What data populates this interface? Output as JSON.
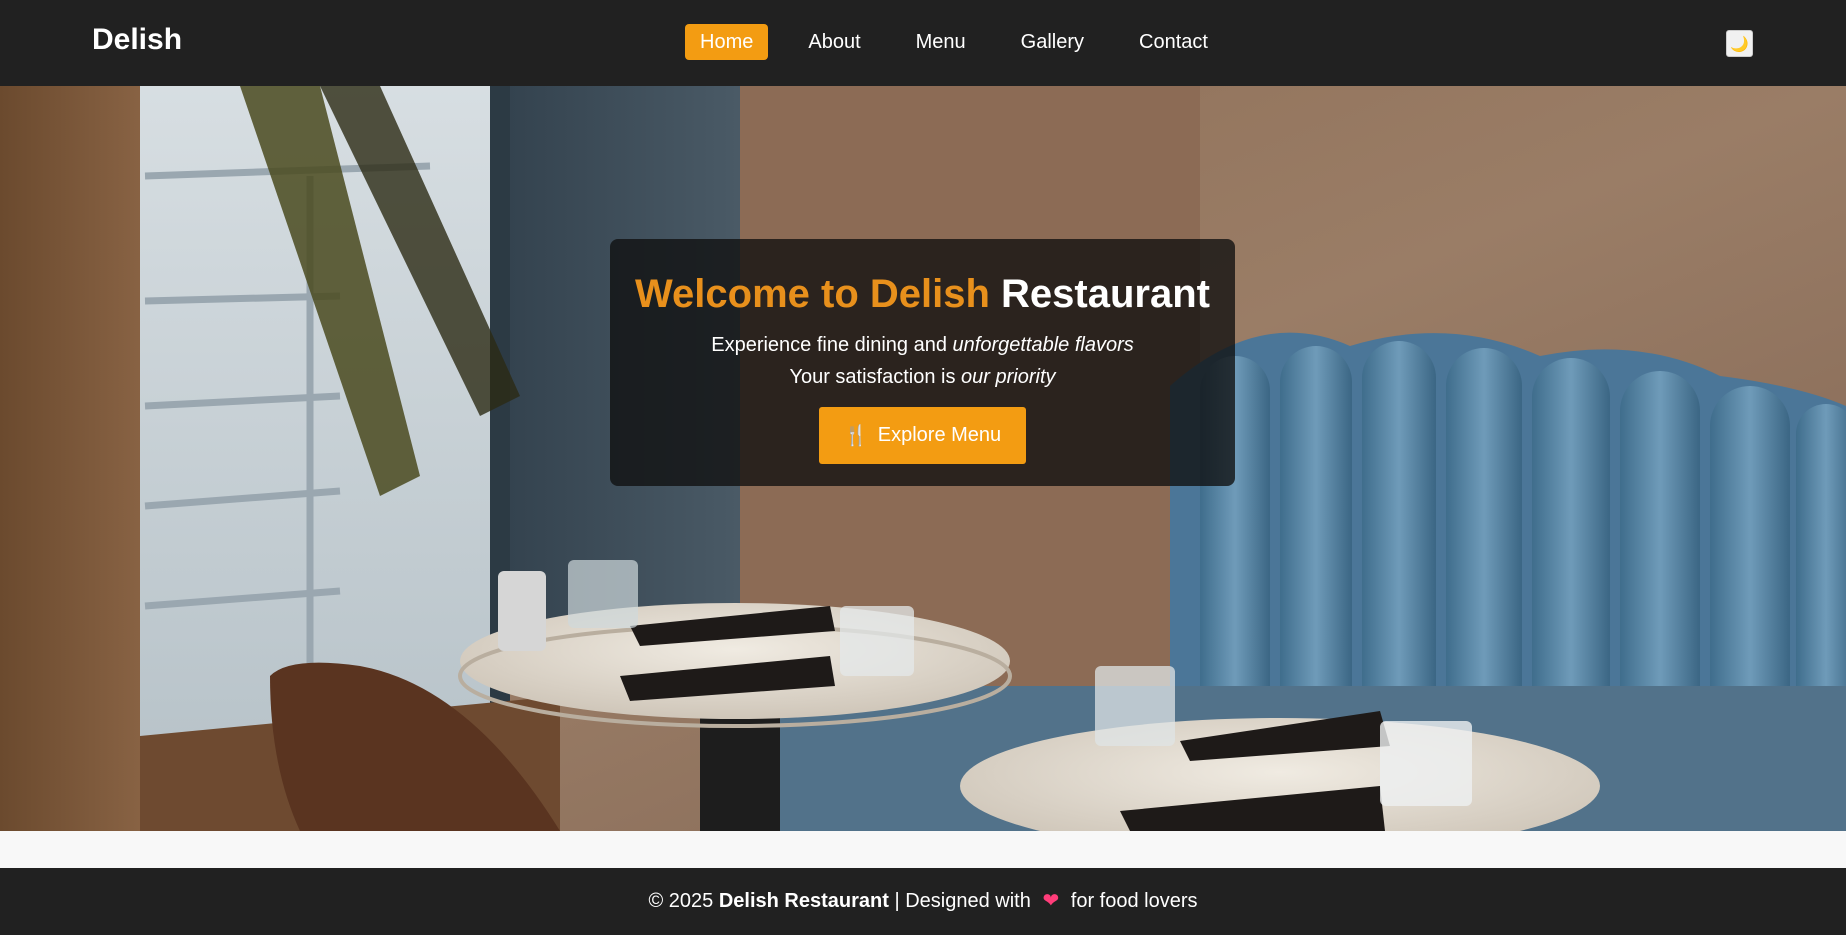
{
  "navbar": {
    "brand": "Delish",
    "links": [
      {
        "label": "Home",
        "active": true
      },
      {
        "label": "About",
        "active": false
      },
      {
        "label": "Menu",
        "active": false
      },
      {
        "label": "Gallery",
        "active": false
      },
      {
        "label": "Contact",
        "active": false
      }
    ],
    "theme_toggle_icon": "moon-icon",
    "theme_toggle_glyph": "🌙"
  },
  "hero": {
    "title_accent": "Welcome to Delish",
    "title_rest": "Restaurant",
    "line1_prefix": "Experience fine dining and",
    "line1_emphasis": "unforgettable flavors",
    "line2_prefix": "Your satisfaction is",
    "line2_emphasis": "our priority",
    "cta_icon": "utensils-icon",
    "cta_glyph": "🍴",
    "cta_label": "Explore Menu",
    "background_image": "restaurant-interior-photo"
  },
  "footer": {
    "copyright": "© 2025",
    "company": "Delish Restaurant",
    "separator": "| Designed with",
    "heart_icon": "heart-icon",
    "heart_glyph": "❤",
    "suffix": "for food lovers"
  },
  "colors": {
    "accent": "#f39c12",
    "navbar_bg": "#212121",
    "footer_bg": "#212121",
    "heart": "#ff3d7a"
  }
}
